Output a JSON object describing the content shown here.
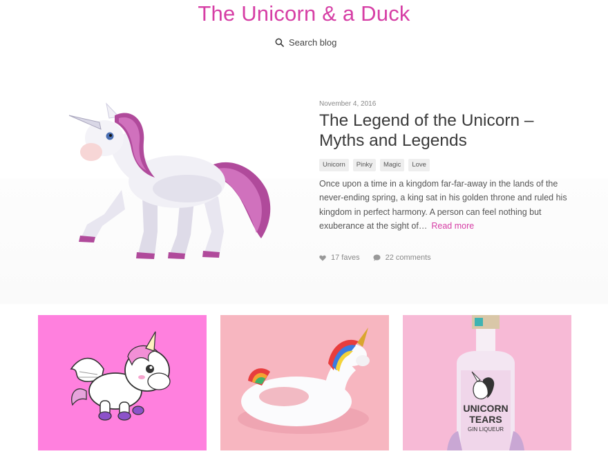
{
  "site": {
    "title": "The Unicorn & a Duck"
  },
  "search": {
    "label": "Search blog",
    "icon": "search-icon"
  },
  "featured_post": {
    "date": "November 4, 2016",
    "title_line1": "The Legend of the Unicorn –",
    "title_line2": "Myths and Legends",
    "tags": [
      "Unicorn",
      "Pinky",
      "Magic",
      "Love"
    ],
    "excerpt": "Once upon a time in a kingdom far-far-away in the lands of the never-ending spring, a king sat in his golden throne and ruled his kingdom in perfect harmony. A person can feel nothing but exuberance at the sight of…",
    "read_more": "Read more",
    "faves": "17 faves",
    "comments": "22 comments"
  },
  "cards": [
    {
      "image": "cartoon-winged-unicorn",
      "background": "#ff80de"
    },
    {
      "image": "inflatable-unicorn-float",
      "background": "#f7b6c0"
    },
    {
      "image": "unicorn-tears-gin-bottle",
      "background": "#f7bad6",
      "label_line1": "UNICORN",
      "label_line2": "TEARS",
      "label_line3": "GIN LIQUEUR"
    }
  ],
  "colors": {
    "accent": "#d63ea5",
    "text": "#4a4a4a",
    "muted": "#888888",
    "tag_bg": "#eeeeee"
  }
}
